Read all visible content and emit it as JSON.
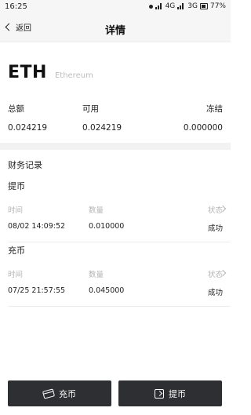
{
  "status_bar": {
    "time": "16:25",
    "network_4g": "4G",
    "network_3g": "3G",
    "battery": "77%"
  },
  "nav": {
    "back_label": "返回",
    "title": "详情"
  },
  "coin": {
    "symbol": "ETH",
    "name": "Ethereum"
  },
  "balances": {
    "headers": [
      "总额",
      "可用",
      "冻结"
    ],
    "values": [
      "0.024219",
      "0.024219",
      "0.000000"
    ]
  },
  "records": {
    "title": "财务记录",
    "items": [
      {
        "type": "提币",
        "headers": [
          "时间",
          "数量",
          "状态"
        ],
        "time": "08/02 14:09:52",
        "amount": "0.010000",
        "status": "成功"
      },
      {
        "type": "充币",
        "headers": [
          "时间",
          "数量",
          "状态"
        ],
        "time": "07/25 21:57:55",
        "amount": "0.045000",
        "status": "成功"
      }
    ]
  },
  "actions": {
    "deposit_label": "充币",
    "withdraw_label": "提币"
  },
  "icons": {
    "back": "chevron-left-icon",
    "record_arrow": "chevron-right-icon",
    "deposit": "card-icon",
    "withdraw": "withdraw-icon"
  }
}
